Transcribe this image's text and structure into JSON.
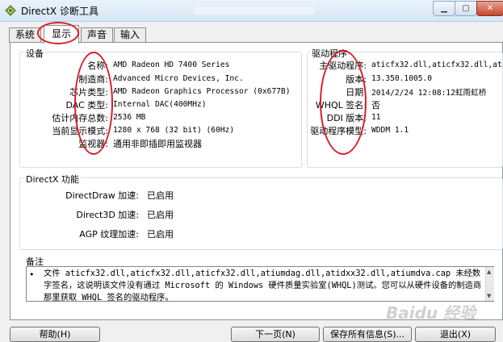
{
  "window": {
    "title": "DirectX 诊断工具"
  },
  "tabs": [
    {
      "label": "系统"
    },
    {
      "label": "显示"
    },
    {
      "label": "声音"
    },
    {
      "label": "输入"
    }
  ],
  "device": {
    "title": "设备",
    "rows": [
      {
        "label": "名称:",
        "value": "AMD Radeon HD 7400 Series"
      },
      {
        "label": "制造商:",
        "value": "Advanced Micro Devices, Inc."
      },
      {
        "label": "芯片类型:",
        "value": "AMD Radeon Graphics Processor (0x677B)"
      },
      {
        "label": "DAC 类型:",
        "value": "Internal DAC(400MHz)"
      },
      {
        "label": "估计内存总数:",
        "value": "2536 MB"
      },
      {
        "label": "当前显示模式:",
        "value": "1280 x 768 (32 bit) (60Hz)"
      },
      {
        "label": "监视器:",
        "value": "通用非即插即用监视器"
      }
    ]
  },
  "driver": {
    "title": "驱动程序",
    "rows": [
      {
        "label": "主驱动程序:",
        "value": "aticfx32.dll,aticfx32.dll,atic"
      },
      {
        "label": "版本:",
        "value": "13.350.1005.0"
      },
      {
        "label": "日期:",
        "value": "2014/2/24 12:08:12虹雨虹桥"
      },
      {
        "label": "WHQL 签名:",
        "value": "否"
      },
      {
        "label": "DDI 版本:",
        "value": "11"
      },
      {
        "label": "驱动程序模型:",
        "value": "WDDM 1.1"
      }
    ]
  },
  "directx": {
    "title": "DirectX 功能",
    "rows": [
      {
        "label": "DirectDraw 加速:",
        "value": "已启用"
      },
      {
        "label": "Direct3D 加速:",
        "value": "已启用"
      },
      {
        "label": "AGP 纹理加速:",
        "value": "已启用"
      }
    ]
  },
  "notes": {
    "title": "备注",
    "bullet": "•",
    "text": "文件 aticfx32.dll,aticfx32.dll,aticfx32.dll,atiumdag.dll,atidxx32.dll,atiumdva.cap 未经数字签名，这说明该文件没有通过 Microsoft 的 Windows 硬件质量实验室(WHQL)测试。您可以从硬件设备的制造商那里获取 WHQL 签名的驱动程序。"
  },
  "buttons": {
    "help": "帮助(H)",
    "next": "下一页(N)",
    "save": "保存所有信息(S)...",
    "exit": "退出(X)"
  },
  "watermark": "Baidu 经验",
  "icons": {
    "app": "directx-icon",
    "minimize": "minimize-icon",
    "maximize": "maximize-icon",
    "close": "close-icon"
  },
  "colors": {
    "annotation": "#d8202a",
    "titlebar": "#d6e6f5"
  }
}
